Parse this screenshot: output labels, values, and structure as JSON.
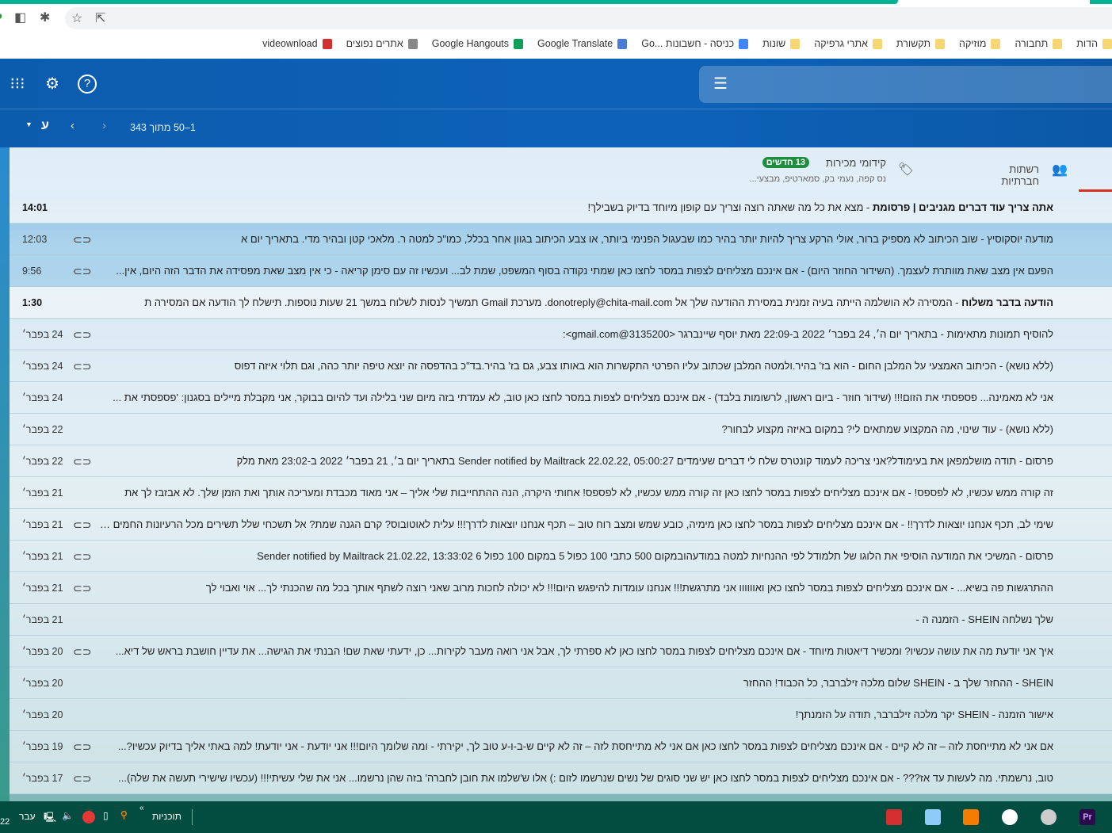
{
  "bookmarks": [
    {
      "label": "הדות",
      "color": "#f7d774"
    },
    {
      "label": "תחבורה",
      "color": "#f7d774"
    },
    {
      "label": "מוזיקה",
      "color": "#f7d774"
    },
    {
      "label": "תקשורת",
      "color": "#f7d774"
    },
    {
      "label": "אתרי גרפיקה",
      "color": "#f7d774"
    },
    {
      "label": "שונות",
      "color": "#f7d774"
    },
    {
      "label": "כניסה - חשבונות ...Go",
      "color": "#4285f4"
    },
    {
      "label": "Google Translate",
      "color": "#4a7bd6"
    },
    {
      "label": "Google Hangouts",
      "color": "#0f9d58"
    },
    {
      "label": "אתרים נפוצים",
      "color": "#888"
    },
    {
      "label": "videownload",
      "color": "#d32f2f"
    }
  ],
  "header": {
    "pager": "1–50 מתוך 343",
    "input_lang": "ע"
  },
  "tabs": {
    "social": {
      "label": "רשתות חברתיות"
    },
    "promotions": {
      "label": "קידומי מכירות",
      "badge": "13 חדשים",
      "senders": "נס קפה, נעמי בק, סמארטיפ, מבצעי..."
    }
  },
  "colors": {
    "accent": "#1e8e3e",
    "header": "#0c5cae"
  },
  "emails": [
    {
      "subject": "אתה צריך עוד דברים מגניבים | פרסומת",
      "snippet": "מצא את כל מה שאתה רוצה וצריך עם קופון מיוחד בדיוק בשבילך!",
      "date": "14:01",
      "unread": true,
      "attachment": false
    },
    {
      "subject": "מודעה יוסקוסיץ",
      "snippet": "שוב הכיתוב לא מספיק ברור, אולי הרקע צריך להיות יותר בהיר כמו שבעגול הפנימי ביותר, או צבע הכיתוב בגוון אחר בכלל, כמו\"כ למטה ר. מלאכי קטן ובהיר מדי. בתאריך יום א",
      "date": "12:03",
      "unread": false,
      "attachment": true,
      "hl": true
    },
    {
      "subject": "הפעם אין מצב שאת מוותרת לעצמך. (השידור החוזר היום)",
      "snippet": "אם אינכם מצליחים לצפות במסר לחצו כאן שמתי נקודה בסוף המשפט, שמת לב... ועכשיו זה עם סימן קריאה - כי אין מצב שאת מפסידה את הדבר הזה היום, אין...",
      "date": "9:56",
      "unread": false,
      "attachment": true,
      "hl": true
    },
    {
      "subject": "הודעה בדבר משלוח",
      "snippet": "המסירה לא הושלמה הייתה בעיה זמנית במסירת ההודעה שלך אל donotreply@chita-mail.com. מערכת Gmail תמשיך לנסות לשלוח במשך 21 שעות נוספות. תישלח לך הודעה אם המסירה ת",
      "date": "1:30",
      "unread": true,
      "attachment": false
    },
    {
      "subject": "להוסיף תמונות מתאימות",
      "snippet": "בתאריך יום ה׳, 24 בפבר׳ 2022 ב-22:09 מאת יוסף שיינברגר <3135200@gmail.com>:",
      "date": "24 בפבר׳",
      "unread": false,
      "attachment": true
    },
    {
      "subject": "(ללא נושא)",
      "snippet": "הכיתוב האמצעי על המלבן החום - הוא בז' בהיר.ולמטה המלבן שכתוב עליו הפרטי התקשרות הוא באותו צבע, גם בז' בהיר.בד\"כ בהדפסה זה יוצא טיפה יותר כהה, וגם תלוי איזה דפוס",
      "date": "24 בפבר׳",
      "unread": false,
      "attachment": true
    },
    {
      "subject": "אני לא מאמינה... פספסתי את הזום!!! (שידור חוזר - ביום ראשון, לרשומות בלבד)",
      "snippet": "אם אינכם מצליחים לצפות במסר לחצו כאן טוב, לא עמדתי בזה מיום שני בלילה ועד להיום בבוקר, אני מקבלת מיילים בסגנון: 'פספסתי את ...",
      "date": "24 בפבר׳",
      "unread": false,
      "attachment": false
    },
    {
      "subject": "(ללא נושא)",
      "snippet": "עוד שינוי, מה המקצוע שמתאים לי? במקום באיזה מקצוע לבחור?",
      "date": "22 בפבר׳",
      "unread": false,
      "attachment": false
    },
    {
      "subject": "פרסום",
      "snippet": "תודה מושלמפאן את בעימודל?אני צריכה לעמוד קונטרס שלח לי דברים שעימדים Sender notified by Mailtrack 22.02.22, 05:00:27 בתאריך יום ב׳, 21 בפבר׳ 2022 ב-23:02 מאת מלק",
      "date": "22 בפבר׳",
      "unread": false,
      "attachment": true
    },
    {
      "subject": "זה קורה ממש עכשיו, לא לפספס!",
      "snippet": "אם אינכם מצליחים לצפות במסר לחצו כאן זה קורה ממש עכשיו, לא לפספס! אחותי היקרה, הנה ההתחייבות שלי אליך – אני מאוד מכבדת ומעריכה אותך ואת הזמן שלך. לא אבזבז לך את",
      "date": "21 בפבר׳",
      "unread": false,
      "attachment": false
    },
    {
      "subject": "שימי לב, תכף אנחנו יוצאות לדרך!!",
      "snippet": "אם אינכם מצליחים לצפות במסר לחצו כאן מימיה, כובע שמש ומצב רוח טוב – תכף אנחנו יוצאות לדרך!!! עלית לאוטובוס? קרם הגנה שמת? אל תשכחי שלל תשירים מכל הרעיונות החמים שלי!!!!!",
      "date": "21 בפבר׳",
      "unread": false,
      "attachment": true
    },
    {
      "subject": "פרסום",
      "snippet": "המשיכי את המודעה הוסיפי את הלוגו של תלמודל לפי ההנחיות למטה במודעהובמקום 500 כתבי 100 כפול 5 במקום 100 כפול 6 Sender notified by Mailtrack 21.02.22, 13:33:02",
      "date": "21 בפבר׳",
      "unread": false,
      "attachment": true
    },
    {
      "subject": "ההתרגשות פה בשיא...",
      "snippet": "אם אינכם מצליחים לצפות במסר לחצו כאן ואוווווו אני מתרגשת!!! אנחנו עומדות להיפגש היום!!! לא יכולה לחכות מרוב שאני רוצה לשתף אותך בכל מה שהכנתי לך... אוי ואבוי לך",
      "date": "21 בפבר׳",
      "unread": false,
      "attachment": true
    },
    {
      "subject": "שלך נשלחה SHEIN - הזמנה ה",
      "snippet": "",
      "date": "21 בפבר׳",
      "unread": false,
      "attachment": false
    },
    {
      "subject": "איך אני יודעת מה את עושה עכשיו? ומכשיר דיאטות מיוחד",
      "snippet": "אם אינכם מצליחים לצפות במסר לחצו כאן לא ספרתי לך, אבל אני רואה מעבר לקירות... כן, ידעתי שאת שם! הבנתי את הגישה... את עדיין חושבת בראש של דיא...",
      "date": "20 בפבר׳",
      "unread": false,
      "attachment": true
    },
    {
      "subject": "SHEIN - ההחזר שלך ב",
      "snippet": "SHEIN שלום מלכה זילברבר, כל הכבוד! ההחזר",
      "date": "20 בפבר׳",
      "unread": false,
      "attachment": false
    },
    {
      "subject": "אישור הזמנה",
      "snippet": "SHEIN יקר מלכה זילברבר, תודה על הזמנתך!",
      "date": "20 בפבר׳",
      "unread": false,
      "attachment": false
    },
    {
      "subject": "אם אני לא מתייחסת לזה – זה לא קיים",
      "snippet": "אם אינכם מצליחים לצפות במסר לחצו כאן אם אני לא מתייחסת לזה – זה לא קיים ש-ב-ו-ע טוב לך, יקירתי - ומה שלומך היום!!! אני יודעת - אני יודעת! למה באתי אליך בדיוק עכשיו?...",
      "date": "19 בפבר׳",
      "unread": false,
      "attachment": true
    },
    {
      "subject": "טוב, נרשמתי. מה לעשות עד אז???",
      "snippet": "אם אינכם מצליחים לצפות במסר לחצו כאן יש שני סוגים של נשים שנרשמו לזום :) אלו ש'שלמו את חובן לחברה' בזה שהן נרשמו... אני את שלי עשיתי!!! (עכשיו שישירי תעשה את שלה)...",
      "date": "17 בפבר׳",
      "unread": false,
      "attachment": true
    }
  ],
  "taskbar": {
    "programs": "תוכניות",
    "lang": "עבר",
    "clock": "22"
  }
}
